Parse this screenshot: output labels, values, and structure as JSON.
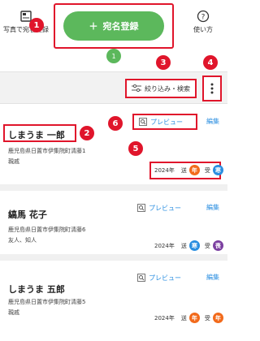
{
  "header": {
    "photo_label": "写真で宛名登録",
    "register_label": "宛名登録",
    "register_icon": "plus-icon",
    "count_badge": "1",
    "help_label": "使い方"
  },
  "filterbar": {
    "filter_label": "絞り込み・検索"
  },
  "callouts": [
    "1",
    "2",
    "3",
    "4",
    "5",
    "6"
  ],
  "cards": [
    {
      "name": "しまうま 一郎",
      "address": "鹿児島県日置市伊集院町清藤1",
      "relation": "親戚",
      "preview_label": "プレビュー",
      "edit_label": "編集",
      "year": "2024年",
      "sent_label": "送",
      "sent_stamp": "年",
      "recv_label": "受",
      "recv_stamp": "寒"
    },
    {
      "name": "縞馬 花子",
      "address": "鹿児島県日置市伊集院町清藤6",
      "relation": "友人、知人",
      "preview_label": "プレビュー",
      "edit_label": "編集",
      "year": "2024年",
      "sent_label": "送",
      "sent_stamp": "寒",
      "recv_label": "受",
      "recv_stamp": "喪"
    },
    {
      "name": "しまうま 五郎",
      "address": "鹿児島県日置市伊集院町清藤5",
      "relation": "親戚",
      "preview_label": "プレビュー",
      "edit_label": "編集",
      "year": "2024年",
      "sent_label": "送",
      "sent_stamp": "年",
      "recv_label": "受",
      "recv_stamp": "年"
    }
  ],
  "colors": {
    "accent_green": "#5cb85c",
    "link_blue": "#2a8ee0",
    "stamp_orange": "#f26a1b",
    "stamp_blue": "#2a8ee0",
    "stamp_purple": "#7b3fa0",
    "callout_red": "#e0152b"
  }
}
